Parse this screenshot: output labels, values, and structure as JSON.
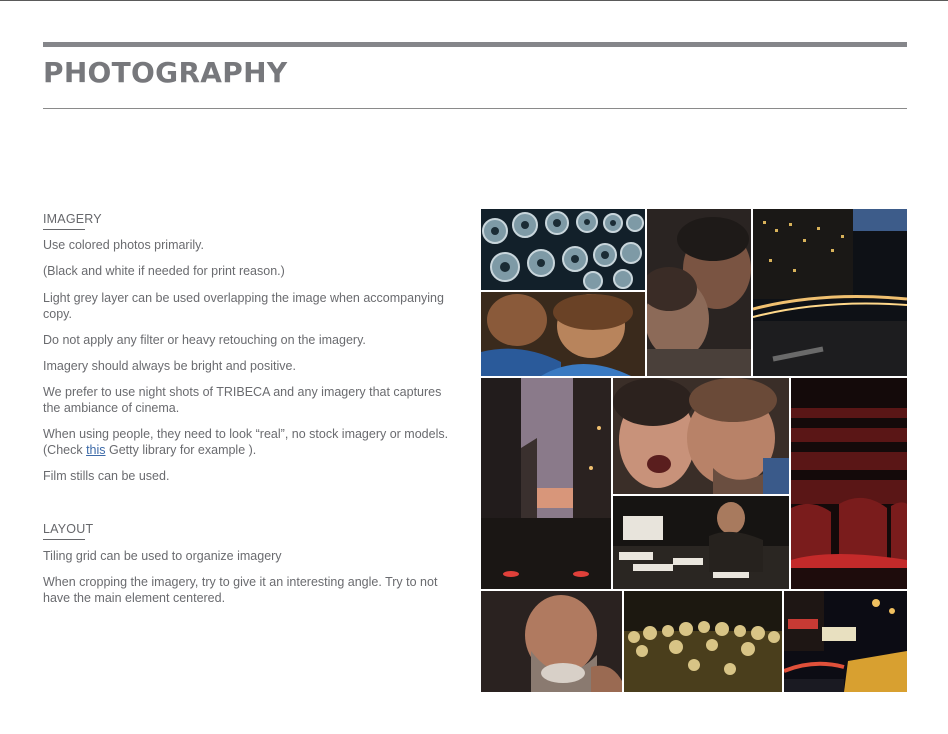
{
  "header": {
    "title": "PHOTOGRAPHY"
  },
  "imagery": {
    "heading": "IMAGERY",
    "p1": "Use colored photos primarily.",
    "p2": "(Black and white if needed for print reason.)",
    "p3": "Light grey layer can be used overlapping the image when accompanying copy.",
    "p4": "Do not apply any filter or heavy retouching on the imagery.",
    "p5": "Imagery should always be bright and positive.",
    "p6": "We prefer to use night shots of TRIBECA and any imagery that captures the ambiance of cinema.",
    "p7_before": "When using people, they need to look “real”, no stock imagery or models. (Check ",
    "p7_link": "this",
    "p7_after": " Getty library for example ).",
    "p8": "Film stills can be used."
  },
  "layout": {
    "heading": "LAYOUT",
    "p1": "Tiling grid can be used to organize imagery",
    "p2": "When cropping the imagery, try to give it an interesting angle. Try to not have the main element centered."
  },
  "colors": {
    "title_grey": "#77787c",
    "rule_grey": "#85868a",
    "body_text": "#6a6b6f",
    "link_blue": "#3d6aa8"
  },
  "photos": [
    {
      "name": "film-reels-photo"
    },
    {
      "name": "mother-child-photo"
    },
    {
      "name": "couple-closeup-photo"
    },
    {
      "name": "night-street-light-trails-photo"
    },
    {
      "name": "city-avenue-dusk-photo"
    },
    {
      "name": "laughing-couple-photo"
    },
    {
      "name": "writer-at-desk-photo"
    },
    {
      "name": "theater-seats-photo"
    },
    {
      "name": "smiling-bearded-man-photo"
    },
    {
      "name": "popcorn-photo"
    },
    {
      "name": "night-taxi-street-photo"
    }
  ]
}
